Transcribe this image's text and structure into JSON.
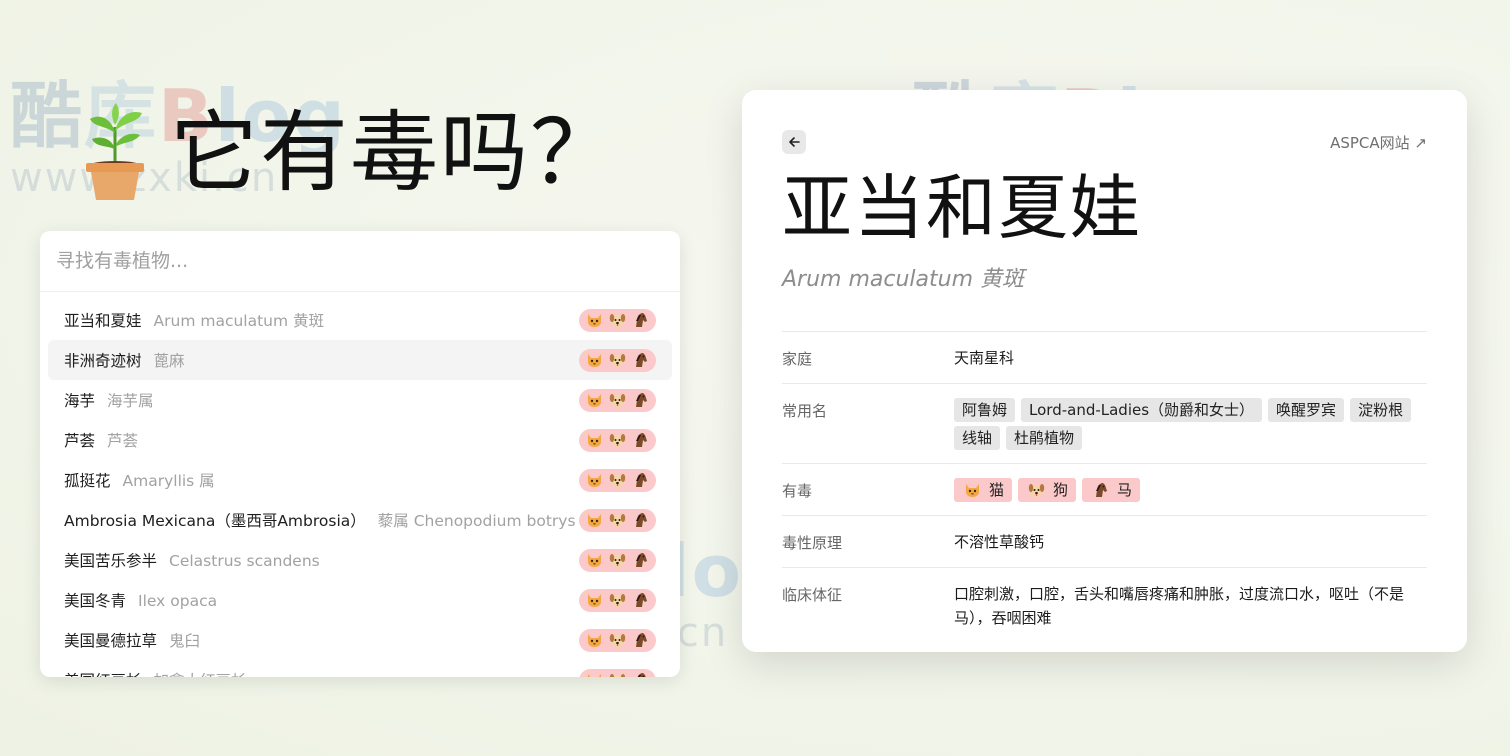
{
  "hero": {
    "title": "它有毒吗？"
  },
  "search": {
    "placeholder": "寻找有毒植物..."
  },
  "plants": [
    {
      "name": "亚当和夏娃",
      "scientific": "Arum maculatum 黄斑"
    },
    {
      "name": "非洲奇迹树",
      "scientific": "蓖麻"
    },
    {
      "name": "海芋",
      "scientific": "海芋属"
    },
    {
      "name": "芦荟",
      "scientific": "芦荟"
    },
    {
      "name": "孤挺花",
      "scientific": "Amaryllis 属"
    },
    {
      "name": "Ambrosia Mexicana（墨西哥Ambrosia）",
      "scientific": "藜属 Chenopodium botrys"
    },
    {
      "name": "美国苦乐参半",
      "scientific": "Celastrus scandens"
    },
    {
      "name": "美国冬青",
      "scientific": "Ilex opaca"
    },
    {
      "name": "美国曼德拉草",
      "scientific": "鬼臼"
    },
    {
      "name": "美国红豆杉",
      "scientific": "加拿大红豆杉"
    }
  ],
  "detail": {
    "link_label": "ASPCA网站 ↗",
    "title": "亚当和夏娃",
    "subtitle": "Arum maculatum 黄斑",
    "family_label": "家庭",
    "family_value": "天南星科",
    "common_label": "常用名",
    "common_names": [
      "阿鲁姆",
      "Lord-and-Ladies（勋爵和女士）",
      "唤醒罗宾",
      "淀粉根",
      "线轴",
      "杜鹃植物"
    ],
    "toxic_label": "有毒",
    "toxic_to": [
      {
        "label": "猫",
        "icon": "cat-icon"
      },
      {
        "label": "狗",
        "icon": "dog-icon"
      },
      {
        "label": "马",
        "icon": "horse-icon"
      }
    ],
    "principle_label": "毒性原理",
    "principle_value": "不溶性草酸钙",
    "signs_label": "临床体征",
    "signs_value": "口腔刺激，口腔，舌头和嘴唇疼痛和肿胀，过度流口水，呕吐（不是马），吞咽困难"
  },
  "watermark": {
    "brand": [
      "酷",
      "库",
      "B",
      "log"
    ],
    "url": "www.zxki.cn"
  },
  "colors": {
    "toxic_pill": "#fbc9c9",
    "tag": "#e6e6e6",
    "pot": "#e8a86a",
    "leaf": "#6bbf3a"
  }
}
